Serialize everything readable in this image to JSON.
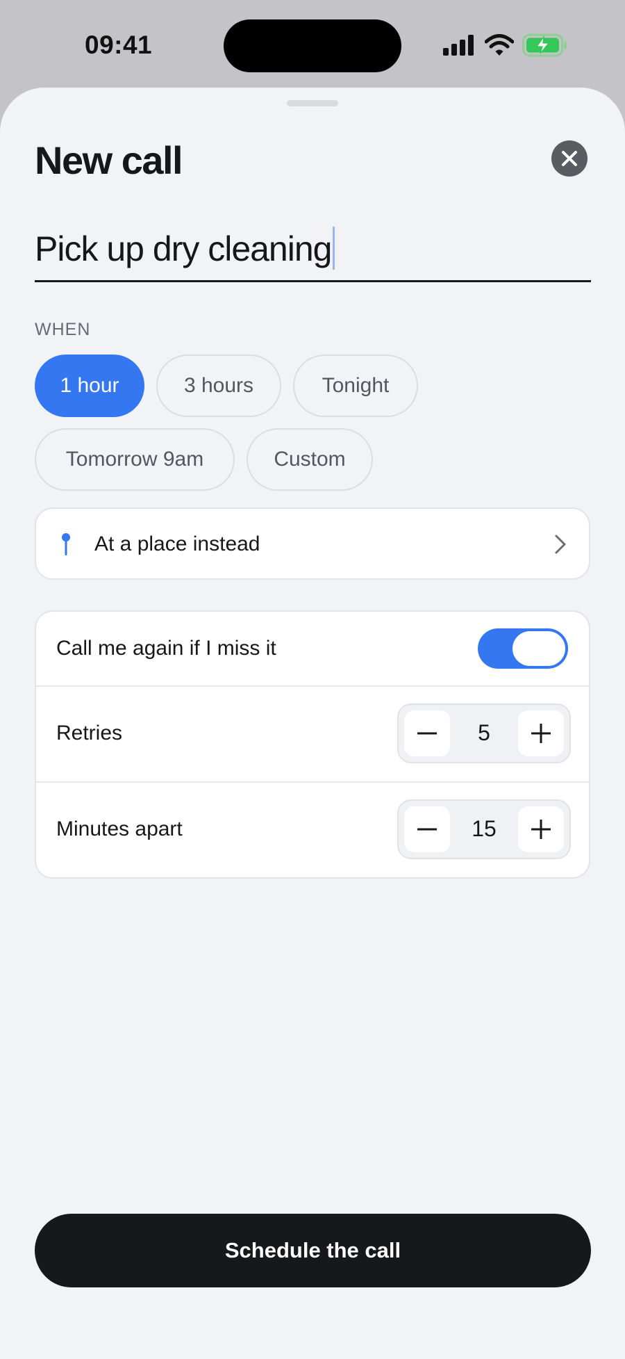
{
  "status_bar": {
    "time": "09:41",
    "icons": [
      "cellular-signal-icon",
      "wifi-icon",
      "battery-charging-icon"
    ],
    "battery_color": "#34c759"
  },
  "sheet": {
    "title": "New call",
    "close_icon": "close-icon",
    "reminder_name": "Pick up dry cleaning",
    "when": {
      "label": "WHEN",
      "options": [
        {
          "label": "1 hour",
          "selected": true
        },
        {
          "label": "3 hours",
          "selected": false
        },
        {
          "label": "Tonight",
          "selected": false
        },
        {
          "label": "Tomorrow 9am",
          "selected": false
        },
        {
          "label": "Custom",
          "selected": false
        }
      ]
    },
    "place_option": {
      "label": "At a place instead",
      "icon": "map-pin-icon",
      "chevron_icon": "chevron-right-icon"
    },
    "options": {
      "call_again": {
        "label": "Call me again if I miss it",
        "enabled": true
      },
      "retries": {
        "label": "Retries",
        "value": "5"
      },
      "minutes_apart": {
        "label": "Minutes apart",
        "value": "15"
      }
    },
    "submit_label": "Schedule the call"
  },
  "colors": {
    "accent": "#3577f0",
    "background": "#f2f3f7",
    "primary_button": "#17181c",
    "text": "#16171b"
  }
}
